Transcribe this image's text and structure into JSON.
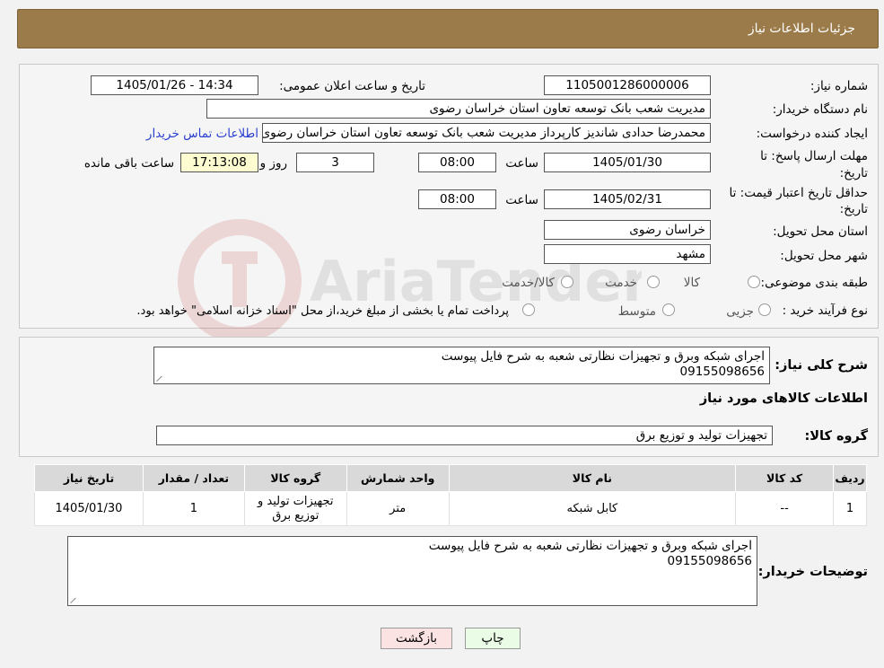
{
  "header": {
    "title": "جزئیات اطلاعات نیاز"
  },
  "watermark": {
    "text": "AriaTender.neT"
  },
  "form": {
    "need_number_label": "شماره نیاز:",
    "need_number": "1105001286000006",
    "announce_label": "تاریخ و ساعت اعلان عمومی:",
    "announce_value": "1405/01/26 - 14:34",
    "buyer_org_label": "نام دستگاه خریدار:",
    "buyer_org": "مدیریت شعب بانک توسعه تعاون استان خراسان رضوی",
    "creator_label": "ایجاد کننده درخواست:",
    "creator": "محمدرضا حدادی شاندیز کارپرداز مدیریت شعب بانک توسعه تعاون استان خراسان رضوی",
    "contact_link": "اطلاعات تماس خریدار",
    "deadline_label_1": "مهلت ارسال پاسخ: تا",
    "deadline_label_2": "تاریخ:",
    "deadline_date": "1405/01/30",
    "time_label": "ساعت",
    "deadline_time": "08:00",
    "days_value": "3",
    "days_label": "روز و",
    "remaining_time": "17:13:08",
    "remaining_label": "ساعت باقی مانده",
    "validity_label_1": "حداقل تاریخ اعتبار قیمت: تا",
    "validity_label_2": "تاریخ:",
    "validity_date": "1405/02/31",
    "validity_time": "08:00",
    "province_label": "استان محل تحویل:",
    "province": "خراسان رضوی",
    "city_label": "شهر محل تحویل:",
    "city": "مشهد",
    "category_label": "طبقه بندی موضوعی:",
    "category_options": [
      "کالا",
      "خدمت",
      "کالا/خدمت"
    ],
    "process_label": "نوع فرآیند خرید :",
    "process_options": [
      "جزیی",
      "متوسط"
    ],
    "process_note": "پرداخت تمام یا بخشی از مبلغ خرید،از محل \"اسناد خزانه اسلامی\" خواهد بود."
  },
  "summary": {
    "label": "شرح کلی نیاز:",
    "line1": "اجرای شبکه وبرق و تجهیزات نظارتی شعبه به شرح فایل پیوست",
    "line2": "09155098656",
    "goods_info_title": "اطلاعات کالاهای مورد نیاز",
    "goods_group_label": "گروه کالا:",
    "goods_group": "تجهیزات تولید و توزیع برق"
  },
  "table": {
    "headers": [
      "ردیف",
      "کد کالا",
      "نام کالا",
      "واحد شمارش",
      "گروه کالا",
      "تعداد / مقدار",
      "تاریخ نیاز"
    ],
    "rows": [
      {
        "row": "1",
        "code": "--",
        "name": "کابل شبکه",
        "unit": "متر",
        "group_line1": "تجهیزات تولید و",
        "group_line2": "توزیع برق",
        "qty": "1",
        "date": "1405/01/30"
      }
    ]
  },
  "buyer_notes": {
    "label": "توضیحات خریدار:",
    "line1": "اجرای شبکه وبرق و تجهیزات نظارتی شعبه به شرح فایل پیوست",
    "line2": "09155098656"
  },
  "buttons": {
    "print": "چاپ",
    "back": "بازگشت"
  }
}
